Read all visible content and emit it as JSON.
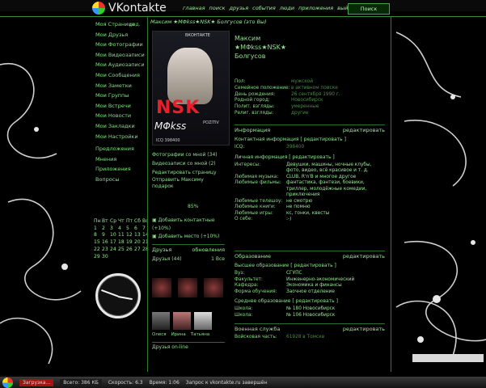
{
  "colors": {
    "accent": "#7fe07f",
    "dim": "#4b8a4b",
    "background": "#000000",
    "red": "#e81f2a"
  },
  "header": {
    "logo": "VKontakte",
    "nav": [
      "главная",
      "поиск",
      "друзья",
      "события",
      "люди",
      "приложения",
      "выйти"
    ],
    "search": "Поиск"
  },
  "sidebar": {
    "edit": "ред.",
    "items": [
      "Моя Страница",
      "Мои Друзья",
      "Мои Фотографии",
      "Мои Видеозаписи",
      "Мои Аудиозаписи",
      "Мои Сообщения",
      "Мои Заметки",
      "Мои Группы",
      "Мои Встречи",
      "Мои Новости",
      "Мои Закладки",
      "Мои Настройки",
      "Предложения",
      "Мнения",
      "Приложения",
      "Вопросы"
    ]
  },
  "calendar": {
    "weekdays": [
      "Пн",
      "Вт",
      "Ср",
      "Чт",
      "Пт",
      "Сб",
      "Вс"
    ],
    "rows": [
      [
        "1",
        "2",
        "3",
        "4",
        "5",
        "6",
        "7"
      ],
      [
        "8",
        "9",
        "10",
        "11",
        "12",
        "13",
        "14"
      ],
      [
        "15",
        "16",
        "17",
        "18",
        "19",
        "20",
        "21"
      ],
      [
        "22",
        "23",
        "24",
        "25",
        "26",
        "27",
        "28"
      ],
      [
        "29",
        "30",
        "",
        "",
        "",
        "",
        ""
      ]
    ]
  },
  "profile": {
    "title_name": "Максим ★MΦkss★NSK★ Болгусов (это Вы)",
    "name_line1": "Максим",
    "name_line2": "★MΦkss★NSK★",
    "name_line3": "Болгусов",
    "photo_top": "ВКОНТАКТЕ",
    "photo_nsk": "NSK",
    "photo_sig": "MΦkss",
    "photo_line": "ICQ 398400",
    "photo_pozitiv": "POZITIV",
    "info_labels": [
      "Пол:",
      "Семейное положение:",
      "День рождения:",
      "Родной город:",
      "Полит. взгляды:",
      "Религ. взгляды:"
    ],
    "info_values": [
      "мужской",
      "в активном поиске",
      "26 сентября 1990 г.",
      "Новосибирск",
      "умеренные",
      "другие"
    ]
  },
  "actions": [
    "Фотографии со мной (34)",
    "Видеозаписи со мной (2)",
    "Редактировать страницу",
    "Отправить Максиму подарок"
  ],
  "percent": "85%",
  "addlinks": [
    "Добавить контактные (+10%)",
    "Добавить место (+10%)"
  ],
  "info_section": {
    "header": "Информация",
    "edit": "редактировать",
    "contact_title": "Контактная информация [ редактировать ]",
    "contact_rows": [
      [
        "ICQ:",
        "398400"
      ]
    ],
    "personal_title": "Личная информация [ редактировать ]",
    "personal_rows": [
      [
        "Интересы:",
        "Девушки, машины, ночные клубы, фото, видео, всё красивое и т. д."
      ],
      [
        "Любимая музыка:",
        "CLUB, R'n'B и многое другое"
      ],
      [
        "Любимые фильмы:",
        "фантастика, фэнтези, боевики, триллер, молодёжные комедии, приключения"
      ],
      [
        "Любимые телешоу:",
        "не смотрю"
      ],
      [
        "Любимые книги:",
        "не помню"
      ],
      [
        "Любимые игры:",
        "кс, гонки, квесты"
      ],
      [
        "О себе:",
        ":-)"
      ]
    ]
  },
  "education": {
    "header": "Образование",
    "edit": "редактировать",
    "higher_title": "Высшее образование [ редактировать ]",
    "higher_rows": [
      [
        "Вуз:",
        "СГУПС"
      ],
      [
        "Факультет:",
        "Инженерно-экономический"
      ],
      [
        "Кафедра:",
        "Экономика и финансы"
      ],
      [
        "Форма обучения:",
        "Заочное отделение"
      ]
    ],
    "school_title": "Среднее образование [ редактировать ]",
    "school_rows": [
      [
        "Школа:",
        "№ 180 Новосибирск"
      ],
      [
        "Школа:",
        "№ 106 Новосибирск"
      ]
    ]
  },
  "military": {
    "header": "Военная служба",
    "edit": "редактировать",
    "row": [
      "Войсковая часть:",
      "61928 в Томске"
    ]
  },
  "friends": {
    "header": "Друзья",
    "updates": "обновления",
    "count": "Друзья (44)",
    "all": "1 Все",
    "names": [
      "Олеся",
      "Ирина",
      "Татьяна"
    ],
    "online": "Друзья on-line"
  },
  "taskbar": {
    "ie": "Загрузка...",
    "size": "Всего: 386 КБ",
    "speed": "Скорость: 6.3",
    "time": "Время: 1:06",
    "status": "Запрос к vkontakte.ru завершён"
  }
}
